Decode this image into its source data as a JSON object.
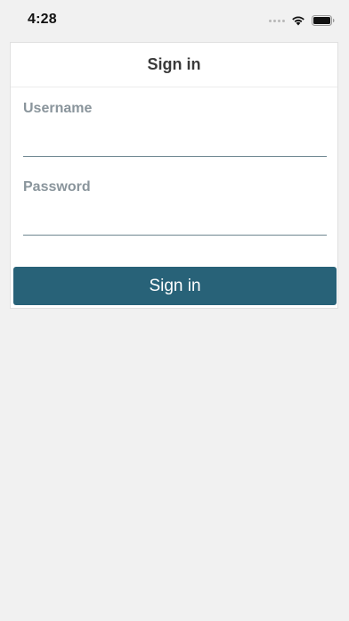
{
  "status_bar": {
    "time": "4:28"
  },
  "signin_card": {
    "title": "Sign in",
    "username": {
      "label": "Username",
      "value": ""
    },
    "password": {
      "label": "Password",
      "value": ""
    },
    "submit_label": "Sign in",
    "accent_color": "#286278"
  }
}
